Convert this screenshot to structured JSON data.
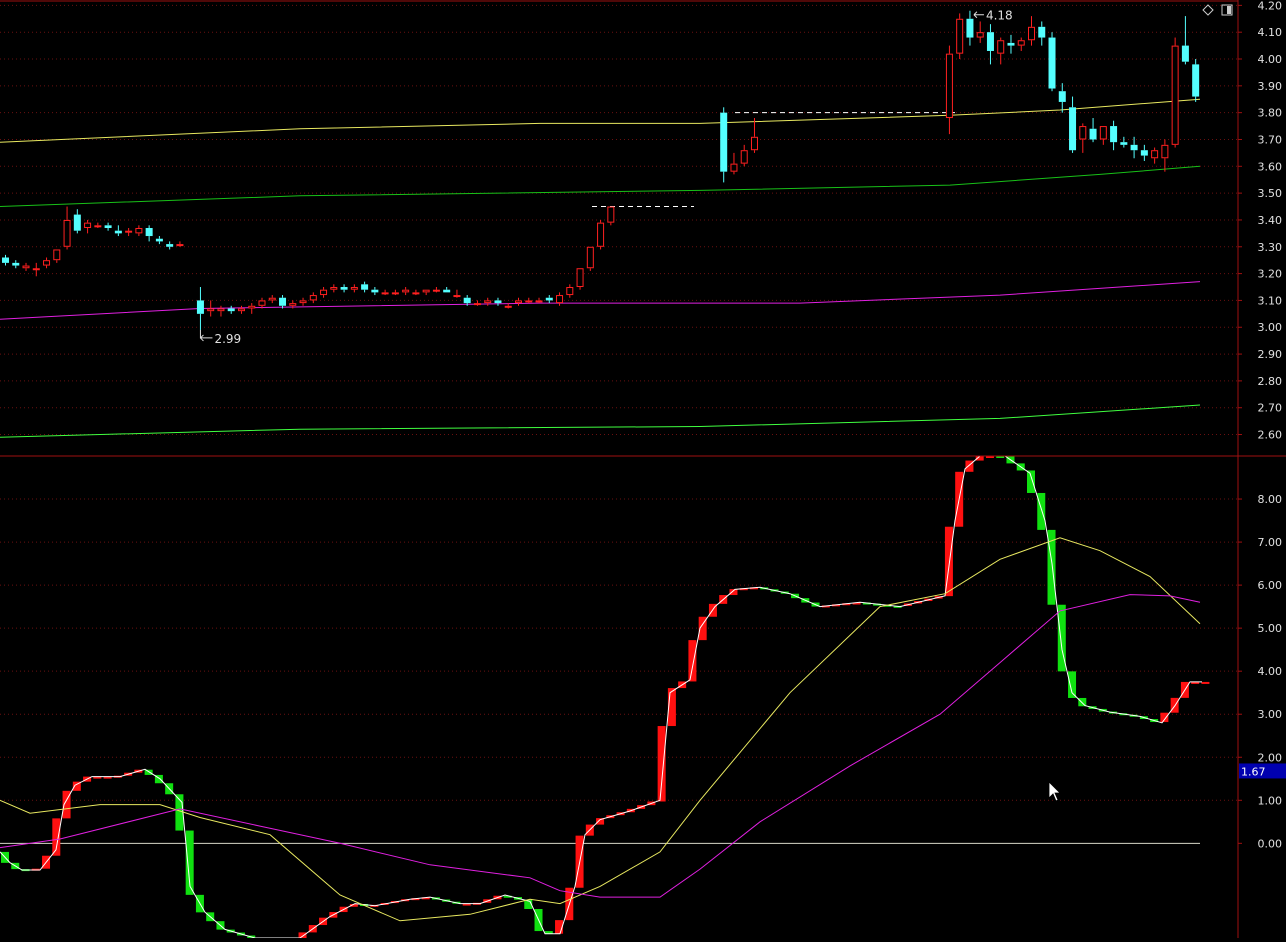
{
  "colors": {
    "background": "#000000",
    "up": "#ff2020",
    "down": "#54ffff",
    "ind_up": "#ff1010",
    "ind_down": "#10e010",
    "ma_yellow": "#e8e860",
    "ma_green": "#18c018",
    "ma_green2": "#40ff40",
    "ma_magenta": "#e020e0",
    "grid": "#6a1010",
    "axis_text": "#e0e0e0",
    "label_box": "#0000b0"
  },
  "icons": {
    "top_left": "diamond-icon",
    "top_right": "window-toggle-icon"
  },
  "chart_data": [
    {
      "type": "candlestick",
      "price_ticks": [
        "4.20",
        "4.10",
        "4.00",
        "3.90",
        "3.80",
        "3.70",
        "3.60",
        "3.50",
        "3.40",
        "3.30",
        "3.20",
        "3.10",
        "3.00",
        "2.90",
        "2.80",
        "2.70",
        "2.60"
      ],
      "ylim": [
        2.52,
        4.22
      ],
      "high_label": "4.18",
      "low_label": "2.99",
      "candles": [
        [
          3.26,
          3.27,
          3.23,
          3.24
        ],
        [
          3.24,
          3.25,
          3.22,
          3.23
        ],
        [
          3.22,
          3.24,
          3.21,
          3.23
        ],
        [
          3.22,
          3.24,
          3.19,
          3.22
        ],
        [
          3.23,
          3.26,
          3.22,
          3.25
        ],
        [
          3.25,
          3.29,
          3.24,
          3.29
        ],
        [
          3.3,
          3.45,
          3.29,
          3.4
        ],
        [
          3.42,
          3.44,
          3.35,
          3.36
        ],
        [
          3.37,
          3.4,
          3.35,
          3.39
        ],
        [
          3.38,
          3.39,
          3.37,
          3.38
        ],
        [
          3.38,
          3.39,
          3.36,
          3.37
        ],
        [
          3.36,
          3.38,
          3.34,
          3.35
        ],
        [
          3.36,
          3.37,
          3.34,
          3.36
        ],
        [
          3.35,
          3.38,
          3.34,
          3.37
        ],
        [
          3.37,
          3.38,
          3.32,
          3.34
        ],
        [
          3.33,
          3.34,
          3.31,
          3.32
        ],
        [
          3.31,
          3.32,
          3.29,
          3.3
        ],
        [
          3.31,
          3.32,
          3.3,
          3.31
        ],
        null,
        [
          3.1,
          3.15,
          2.99,
          3.05
        ],
        [
          3.06,
          3.1,
          3.04,
          3.07
        ],
        [
          3.06,
          3.08,
          3.04,
          3.07
        ],
        [
          3.07,
          3.08,
          3.05,
          3.06
        ],
        [
          3.06,
          3.08,
          3.05,
          3.07
        ],
        [
          3.07,
          3.09,
          3.05,
          3.08
        ],
        [
          3.08,
          3.11,
          3.07,
          3.1
        ],
        [
          3.1,
          3.12,
          3.09,
          3.11
        ],
        [
          3.11,
          3.12,
          3.07,
          3.08
        ],
        [
          3.08,
          3.1,
          3.07,
          3.09
        ],
        [
          3.09,
          3.11,
          3.08,
          3.1
        ],
        [
          3.1,
          3.13,
          3.09,
          3.12
        ],
        [
          3.12,
          3.15,
          3.11,
          3.14
        ],
        [
          3.14,
          3.16,
          3.13,
          3.15
        ],
        [
          3.15,
          3.16,
          3.13,
          3.14
        ],
        [
          3.14,
          3.16,
          3.13,
          3.15
        ],
        [
          3.16,
          3.17,
          3.13,
          3.14
        ],
        [
          3.14,
          3.15,
          3.12,
          3.13
        ],
        [
          3.13,
          3.14,
          3.12,
          3.13
        ],
        [
          3.13,
          3.14,
          3.12,
          3.13
        ],
        [
          3.13,
          3.15,
          3.12,
          3.14
        ],
        [
          3.13,
          3.14,
          3.12,
          3.13
        ],
        [
          3.13,
          3.14,
          3.12,
          3.14
        ],
        [
          3.14,
          3.15,
          3.13,
          3.14
        ],
        [
          3.14,
          3.15,
          3.13,
          3.13
        ],
        [
          3.12,
          3.14,
          3.11,
          3.12
        ],
        [
          3.11,
          3.12,
          3.08,
          3.09
        ],
        [
          3.09,
          3.1,
          3.08,
          3.09
        ],
        [
          3.09,
          3.11,
          3.08,
          3.1
        ],
        [
          3.1,
          3.11,
          3.08,
          3.09
        ],
        [
          3.08,
          3.09,
          3.07,
          3.08
        ],
        [
          3.09,
          3.11,
          3.08,
          3.1
        ],
        [
          3.1,
          3.11,
          3.09,
          3.1
        ],
        [
          3.1,
          3.11,
          3.09,
          3.1
        ],
        [
          3.11,
          3.12,
          3.09,
          3.1
        ],
        [
          3.09,
          3.13,
          3.08,
          3.12
        ],
        [
          3.12,
          3.16,
          3.11,
          3.15
        ],
        [
          3.15,
          3.22,
          3.14,
          3.22
        ],
        [
          3.22,
          3.3,
          3.21,
          3.3
        ],
        [
          3.3,
          3.4,
          3.29,
          3.39
        ],
        [
          3.39,
          3.45,
          3.38,
          3.45
        ],
        null,
        null,
        null,
        null,
        null,
        null,
        null,
        null,
        null,
        null,
        [
          3.8,
          3.82,
          3.54,
          3.58
        ],
        [
          3.58,
          3.65,
          3.57,
          3.61
        ],
        [
          3.61,
          3.68,
          3.6,
          3.66
        ],
        [
          3.66,
          3.78,
          3.65,
          3.71
        ],
        null,
        null,
        null,
        null,
        null,
        null,
        null,
        null,
        null,
        null,
        null,
        null,
        null,
        null,
        null,
        null,
        null,
        null,
        [
          3.78,
          4.05,
          3.72,
          4.02
        ],
        [
          4.02,
          4.17,
          4.0,
          4.15
        ],
        [
          4.15,
          4.18,
          4.05,
          4.08
        ],
        [
          4.08,
          4.14,
          4.06,
          4.1
        ],
        [
          4.1,
          4.13,
          3.98,
          4.03
        ],
        [
          4.02,
          4.08,
          3.98,
          4.07
        ],
        [
          4.06,
          4.09,
          4.02,
          4.05
        ],
        [
          4.05,
          4.08,
          4.03,
          4.07
        ],
        [
          4.07,
          4.16,
          4.05,
          4.12
        ],
        [
          4.12,
          4.14,
          4.05,
          4.08
        ],
        [
          4.08,
          4.1,
          3.88,
          3.89
        ],
        [
          3.88,
          3.91,
          3.8,
          3.84
        ],
        [
          3.82,
          3.86,
          3.65,
          3.66
        ],
        [
          3.7,
          3.76,
          3.65,
          3.75
        ],
        [
          3.74,
          3.78,
          3.69,
          3.7
        ],
        [
          3.7,
          3.75,
          3.68,
          3.75
        ],
        [
          3.75,
          3.77,
          3.66,
          3.69
        ],
        [
          3.69,
          3.71,
          3.67,
          3.68
        ],
        [
          3.68,
          3.71,
          3.63,
          3.66
        ],
        [
          3.66,
          3.68,
          3.62,
          3.64
        ],
        [
          3.63,
          3.67,
          3.61,
          3.66
        ],
        [
          3.63,
          3.7,
          3.58,
          3.68
        ],
        [
          3.68,
          4.08,
          3.67,
          4.05
        ],
        [
          4.05,
          4.16,
          3.98,
          3.99
        ],
        [
          3.98,
          4.0,
          3.84,
          3.86
        ]
      ],
      "series": [
        {
          "name": "",
          "color": "ma_yellow",
          "values": [
            [
              0,
              3.69
            ],
            [
              300,
              3.74
            ],
            [
              540,
              3.76
            ],
            [
              700,
              3.76
            ],
            [
              950,
              3.79
            ],
            [
              1060,
              3.81
            ],
            [
              1200,
              3.85
            ]
          ]
        },
        {
          "name": "",
          "color": "ma_green",
          "values": [
            [
              0,
              3.45
            ],
            [
              300,
              3.49
            ],
            [
              700,
              3.51
            ],
            [
              950,
              3.53
            ],
            [
              1100,
              3.57
            ],
            [
              1200,
              3.6
            ]
          ]
        },
        {
          "name": "",
          "color": "ma_magenta",
          "values": [
            [
              0,
              3.03
            ],
            [
              200,
              3.07
            ],
            [
              540,
              3.09
            ],
            [
              800,
              3.09
            ],
            [
              1000,
              3.12
            ],
            [
              1200,
              3.17
            ]
          ]
        },
        {
          "name": "",
          "color": "ma_green2",
          "values": [
            [
              0,
              2.59
            ],
            [
              300,
              2.62
            ],
            [
              700,
              2.63
            ],
            [
              1000,
              2.66
            ],
            [
              1200,
              2.71
            ]
          ]
        }
      ],
      "dashed_levels": [
        {
          "from": 592,
          "to": 694,
          "value": 3.45
        },
        {
          "from": 735,
          "to": 955,
          "value": 3.8
        }
      ]
    },
    {
      "type": "indicator",
      "ticks": [
        "8.00",
        "7.00",
        "6.00",
        "5.00",
        "4.00",
        "3.00",
        "2.00",
        "1.00",
        "0.00"
      ],
      "ylim": [
        -2.2,
        9.0
      ],
      "current_label": "1.67",
      "main_line": [
        [
          0,
          -0.2
        ],
        [
          10,
          -0.45
        ],
        [
          22,
          -0.62
        ],
        [
          40,
          -0.62
        ],
        [
          56,
          -0.15
        ],
        [
          64,
          0.9
        ],
        [
          75,
          1.35
        ],
        [
          92,
          1.55
        ],
        [
          120,
          1.55
        ],
        [
          145,
          1.72
        ],
        [
          160,
          1.5
        ],
        [
          182,
          0.95
        ],
        [
          190,
          -1.0
        ],
        [
          205,
          -1.6
        ],
        [
          225,
          -2.0
        ],
        [
          255,
          -2.2
        ],
        [
          300,
          -2.2
        ],
        [
          330,
          -1.7
        ],
        [
          355,
          -1.4
        ],
        [
          375,
          -1.45
        ],
        [
          410,
          -1.3
        ],
        [
          430,
          -1.25
        ],
        [
          460,
          -1.4
        ],
        [
          480,
          -1.4
        ],
        [
          505,
          -1.2
        ],
        [
          530,
          -1.35
        ],
        [
          545,
          -2.1
        ],
        [
          560,
          -2.1
        ],
        [
          575,
          -1.0
        ],
        [
          585,
          0.2
        ],
        [
          600,
          0.55
        ],
        [
          630,
          0.75
        ],
        [
          660,
          1.0
        ],
        [
          670,
          3.5
        ],
        [
          690,
          3.8
        ],
        [
          700,
          5.0
        ],
        [
          715,
          5.5
        ],
        [
          735,
          5.9
        ],
        [
          760,
          5.95
        ],
        [
          790,
          5.8
        ],
        [
          820,
          5.5
        ],
        [
          860,
          5.6
        ],
        [
          900,
          5.5
        ],
        [
          945,
          5.75
        ],
        [
          955,
          7.5
        ],
        [
          965,
          8.7
        ],
        [
          980,
          9.0
        ],
        [
          1005,
          9.0
        ],
        [
          1030,
          8.6
        ],
        [
          1045,
          7.5
        ],
        [
          1052,
          6.5
        ],
        [
          1062,
          4.5
        ],
        [
          1072,
          3.5
        ],
        [
          1085,
          3.2
        ],
        [
          1110,
          3.05
        ],
        [
          1140,
          2.95
        ],
        [
          1162,
          2.8
        ],
        [
          1175,
          3.2
        ],
        [
          1190,
          3.75
        ],
        [
          1202,
          3.75
        ]
      ],
      "series": [
        {
          "name": "",
          "color": "ma_yellow",
          "values": [
            [
              0,
              1.0
            ],
            [
              30,
              0.7
            ],
            [
              100,
              0.9
            ],
            [
              160,
              0.9
            ],
            [
              200,
              0.6
            ],
            [
              270,
              0.2
            ],
            [
              340,
              -1.2
            ],
            [
              400,
              -1.8
            ],
            [
              470,
              -1.65
            ],
            [
              530,
              -1.3
            ],
            [
              560,
              -1.4
            ],
            [
              600,
              -1.0
            ],
            [
              660,
              -0.2
            ],
            [
              700,
              1.0
            ],
            [
              790,
              3.5
            ],
            [
              880,
              5.5
            ],
            [
              945,
              5.8
            ],
            [
              1000,
              6.6
            ],
            [
              1060,
              7.1
            ],
            [
              1100,
              6.8
            ],
            [
              1150,
              6.2
            ],
            [
              1200,
              5.1
            ]
          ]
        },
        {
          "name": "",
          "color": "ma_magenta",
          "values": [
            [
              0,
              -0.1
            ],
            [
              60,
              0.1
            ],
            [
              180,
              0.8
            ],
            [
              260,
              0.4
            ],
            [
              340,
              0.0
            ],
            [
              430,
              -0.5
            ],
            [
              530,
              -0.8
            ],
            [
              560,
              -1.1
            ],
            [
              600,
              -1.25
            ],
            [
              660,
              -1.25
            ],
            [
              700,
              -0.6
            ],
            [
              760,
              0.5
            ],
            [
              850,
              1.8
            ],
            [
              940,
              3.0
            ],
            [
              1000,
              4.2
            ],
            [
              1060,
              5.4
            ],
            [
              1130,
              5.78
            ],
            [
              1170,
              5.75
            ],
            [
              1200,
              5.6
            ]
          ]
        }
      ]
    }
  ]
}
